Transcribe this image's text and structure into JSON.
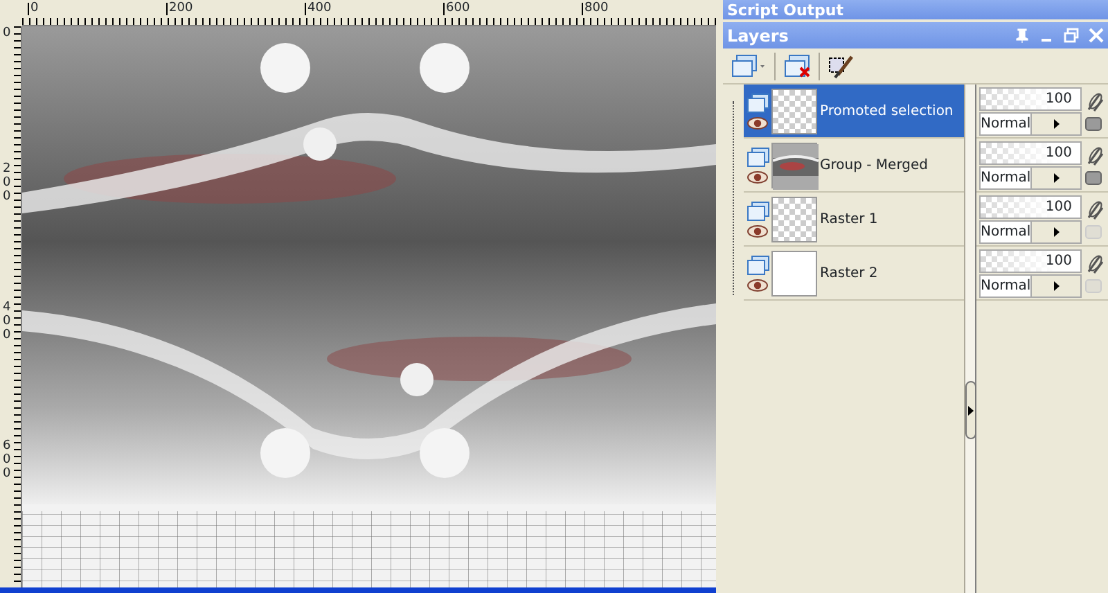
{
  "rulers": {
    "horizontal": [
      "0",
      "200",
      "400",
      "600",
      "800"
    ],
    "vertical": [
      "0",
      "200",
      "400",
      "600"
    ]
  },
  "script_output": {
    "title": "Script Output"
  },
  "layers_panel": {
    "title": "Layers",
    "layers": [
      {
        "name": "Promoted selection",
        "selected": true,
        "kind": "transparent",
        "opacity": "100",
        "level": 1,
        "blend_mode": "Normal",
        "mask": true
      },
      {
        "name": "Group - Merged",
        "selected": false,
        "opacity": "100",
        "level": 1,
        "blend_mode": "Normal",
        "mask": true
      },
      {
        "name": "Raster 1",
        "selected": false,
        "kind": "transparent",
        "opacity": "100",
        "level": 1,
        "blend_mode": "Normal",
        "mask": false
      },
      {
        "name": "Raster 2",
        "selected": false,
        "kind": "white",
        "opacity": "100",
        "level": 1,
        "blend_mode": "Normal",
        "mask": false
      }
    ]
  }
}
